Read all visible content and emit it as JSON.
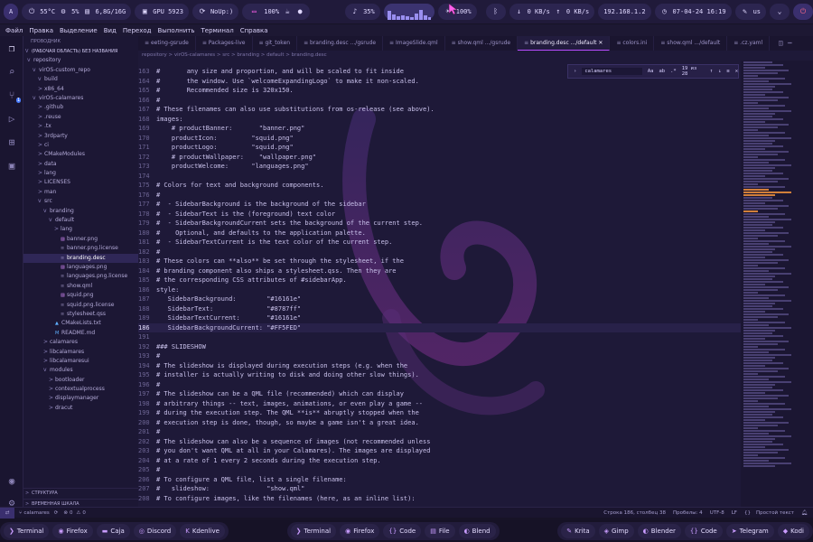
{
  "topbar": {
    "launcher": "A",
    "temp": "55°C",
    "cpu": "5%",
    "mem": "6,8G/16G",
    "gpu": "GPU 5923",
    "noup": "NoUp:)",
    "battery": "100%",
    "volume": "35%",
    "brightness": "100%",
    "net_down": "0 KB/s",
    "net_up": "0 KB/s",
    "ip": "192.168.1.2",
    "clock": "07-04-24 16:19",
    "kbd": "us",
    "accent": "#b84cff"
  },
  "menu": [
    "Файл",
    "Правка",
    "Выделение",
    "Вид",
    "Переход",
    "Выполнить",
    "Терминал",
    "Справка"
  ],
  "explorer": {
    "header": "Проводник",
    "workspace": "(рабочая область) без названия",
    "rows": [
      {
        "d": 0,
        "c": "v",
        "n": "repository",
        "t": "folder"
      },
      {
        "d": 1,
        "c": "v",
        "n": "virOS-custom_repo",
        "t": "folder"
      },
      {
        "d": 2,
        "c": "v",
        "n": "build",
        "t": "folder"
      },
      {
        "d": 2,
        "c": ">",
        "n": "x86_64",
        "t": "folder"
      },
      {
        "d": 1,
        "c": "v",
        "n": "virOS-calamares",
        "t": "folder"
      },
      {
        "d": 2,
        "c": ">",
        "n": ".github",
        "t": "folder"
      },
      {
        "d": 2,
        "c": ">",
        "n": ".reuse",
        "t": "folder"
      },
      {
        "d": 2,
        "c": ">",
        "n": ".tx",
        "t": "folder"
      },
      {
        "d": 2,
        "c": ">",
        "n": "3rdparty",
        "t": "folder"
      },
      {
        "d": 2,
        "c": ">",
        "n": "ci",
        "t": "folder"
      },
      {
        "d": 2,
        "c": ">",
        "n": "CMakeModules",
        "t": "folder"
      },
      {
        "d": 2,
        "c": ">",
        "n": "data",
        "t": "folder"
      },
      {
        "d": 2,
        "c": ">",
        "n": "lang",
        "t": "folder"
      },
      {
        "d": 2,
        "c": ">",
        "n": "LICENSES",
        "t": "folder"
      },
      {
        "d": 2,
        "c": ">",
        "n": "man",
        "t": "folder"
      },
      {
        "d": 2,
        "c": "v",
        "n": "src",
        "t": "folder"
      },
      {
        "d": 3,
        "c": "v",
        "n": "branding",
        "t": "folder"
      },
      {
        "d": 4,
        "c": "v",
        "n": "default",
        "t": "folder"
      },
      {
        "d": 5,
        "c": ">",
        "n": "lang",
        "t": "folder"
      },
      {
        "d": 5,
        "c": "",
        "n": "banner.png",
        "t": "img"
      },
      {
        "d": 5,
        "c": "",
        "n": "banner.png.license",
        "t": "file"
      },
      {
        "d": 5,
        "c": "",
        "n": "branding.desc",
        "t": "file",
        "sel": true
      },
      {
        "d": 5,
        "c": "",
        "n": "languages.png",
        "t": "img"
      },
      {
        "d": 5,
        "c": "",
        "n": "languages.png.license",
        "t": "file"
      },
      {
        "d": 5,
        "c": "",
        "n": "show.qml",
        "t": "file"
      },
      {
        "d": 5,
        "c": "",
        "n": "squid.png",
        "t": "img"
      },
      {
        "d": 5,
        "c": "",
        "n": "squid.png.license",
        "t": "file"
      },
      {
        "d": 5,
        "c": "",
        "n": "stylesheet.qss",
        "t": "file"
      },
      {
        "d": 4,
        "c": "",
        "n": "CMakeLists.txt",
        "t": "cmake"
      },
      {
        "d": 4,
        "c": "",
        "n": "README.md",
        "t": "md"
      },
      {
        "d": 3,
        "c": ">",
        "n": "calamares",
        "t": "folder"
      },
      {
        "d": 3,
        "c": ">",
        "n": "libcalamares",
        "t": "folder"
      },
      {
        "d": 3,
        "c": ">",
        "n": "libcalamaresui",
        "t": "folder"
      },
      {
        "d": 3,
        "c": "v",
        "n": "modules",
        "t": "folder"
      },
      {
        "d": 4,
        "c": ">",
        "n": "bootloader",
        "t": "folder"
      },
      {
        "d": 4,
        "c": ">",
        "n": "contextualprocess",
        "t": "folder"
      },
      {
        "d": 4,
        "c": ">",
        "n": "displaymanager",
        "t": "folder"
      },
      {
        "d": 4,
        "c": ">",
        "n": "dracut",
        "t": "folder"
      }
    ],
    "outline": "Структура",
    "timeline": "Временная шкала"
  },
  "tabs": [
    {
      "label": "eeting-gsrude",
      "active": false
    },
    {
      "label": "Packages-live",
      "active": false
    },
    {
      "label": "git_token",
      "active": false
    },
    {
      "label": "branding.desc .../gsrude",
      "active": false
    },
    {
      "label": "ImageSlide.qml",
      "active": false
    },
    {
      "label": "show.qml .../gsrude",
      "active": false
    },
    {
      "label": "branding.desc .../default",
      "active": true
    },
    {
      "label": "colors.ini",
      "active": false
    },
    {
      "label": "show.qml .../default",
      "active": false
    },
    {
      "label": ".cz.yaml",
      "active": false
    }
  ],
  "breadcrumb": "repository > virOS-calamares > src > branding > default > branding.desc",
  "find": {
    "query": "calamares",
    "result": "19 из 28"
  },
  "code": [
    {
      "n": "163",
      "t": "#       any size and proportion, and will be scaled to fit inside"
    },
    {
      "n": "164",
      "t": "#       the window. Use `welcomeExpandingLogo` to make it non-scaled."
    },
    {
      "n": "165",
      "t": "#       Recommended size is 320x150."
    },
    {
      "n": "166",
      "t": "#"
    },
    {
      "n": "167",
      "t": "# These filenames can also use substitutions from os-release (see above)."
    },
    {
      "n": "168",
      "t": "images:"
    },
    {
      "n": "169",
      "t": "    # productBanner:       \"banner.png\""
    },
    {
      "n": "170",
      "t": "    productIcon:         \"squid.png\""
    },
    {
      "n": "171",
      "t": "    productLogo:         \"squid.png\""
    },
    {
      "n": "172",
      "t": "    # productWallpaper:    \"wallpaper.png\""
    },
    {
      "n": "173",
      "t": "    productWelcome:      \"languages.png\""
    },
    {
      "n": "174",
      "t": ""
    },
    {
      "n": "175",
      "t": "# Colors for text and background components."
    },
    {
      "n": "176",
      "t": "#"
    },
    {
      "n": "177",
      "t": "#  - SidebarBackground is the background of the sidebar"
    },
    {
      "n": "178",
      "t": "#  - SidebarText is the (foreground) text color"
    },
    {
      "n": "179",
      "t": "#  - SidebarBackgroundCurrent sets the background of the current step."
    },
    {
      "n": "180",
      "t": "#    Optional, and defaults to the application palette."
    },
    {
      "n": "181",
      "t": "#  - SidebarTextCurrent is the text color of the current step."
    },
    {
      "n": "182",
      "t": "#"
    },
    {
      "n": "183",
      "t": "# These colors can **also** be set through the stylesheet, if the"
    },
    {
      "n": "184",
      "t": "# branding component also ships a stylesheet.qss. Then they are"
    },
    {
      "n": "185",
      "t": "# the corresponding CSS attributes of #sidebarApp."
    },
    {
      "n": "186",
      "t": "style:"
    },
    {
      "n": "187",
      "t": "   SidebarBackground:        \"#16161e\""
    },
    {
      "n": "188",
      "t": "   SidebarText:              \"#8787ff\""
    },
    {
      "n": "189",
      "t": "   SidebarTextCurrent:       \"#16161e\""
    },
    {
      "n": "186",
      "t": "   SidebarBackgroundCurrent: \"#FF5FED\"",
      "cur": true
    },
    {
      "n": "191",
      "t": ""
    },
    {
      "n": "192",
      "t": "### SLIDESHOW"
    },
    {
      "n": "193",
      "t": "#"
    },
    {
      "n": "194",
      "t": "# The slideshow is displayed during execution steps (e.g. when the"
    },
    {
      "n": "195",
      "t": "# installer is actually writing to disk and doing other slow things)."
    },
    {
      "n": "196",
      "t": "#"
    },
    {
      "n": "197",
      "t": "# The slideshow can be a QML file (recommended) which can display"
    },
    {
      "n": "198",
      "t": "# arbitrary things -- text, images, animations, or even play a game --"
    },
    {
      "n": "199",
      "t": "# during the execution step. The QML **is** abruptly stopped when the"
    },
    {
      "n": "200",
      "t": "# execution step is done, though, so maybe a game isn't a great idea."
    },
    {
      "n": "201",
      "t": "#"
    },
    {
      "n": "202",
      "t": "# The slideshow can also be a sequence of images (not recommended unless"
    },
    {
      "n": "203",
      "t": "# you don't want QML at all in your Calamares). The images are displayed"
    },
    {
      "n": "204",
      "t": "# at a rate of 1 every 2 seconds during the execution step."
    },
    {
      "n": "205",
      "t": "#"
    },
    {
      "n": "206",
      "t": "# To configure a QML file, list a single filename:"
    },
    {
      "n": "207",
      "t": "#   slideshow:               \"show.qml\""
    },
    {
      "n": "208",
      "t": "# To configure images, like the filenames (here, as an inline list):"
    }
  ],
  "statusbar": {
    "branch": "calamares",
    "errors": "0",
    "warnings": "0",
    "position": "Строка 186, столбец 38",
    "spaces": "Пробелы: 4",
    "encoding": "UTF-8",
    "eol": "LF",
    "lang": "Простой текст"
  },
  "taskbar": {
    "left": [
      {
        "icon": "terminal-icon",
        "label": "Terminal"
      },
      {
        "icon": "firefox-icon",
        "label": "Firefox"
      },
      {
        "icon": "folder-icon",
        "label": "Caja"
      },
      {
        "icon": "discord-icon",
        "label": "Discord"
      },
      {
        "icon": "kdenlive-icon",
        "label": "Kdenlive"
      }
    ],
    "center": [
      {
        "icon": "terminal-icon",
        "label": "Terminal"
      },
      {
        "icon": "firefox-icon",
        "label": "Firefox"
      },
      {
        "icon": "code-icon",
        "label": "Code"
      },
      {
        "icon": "file-icon",
        "label": "File"
      },
      {
        "icon": "blender-icon",
        "label": "Blend"
      }
    ],
    "right": [
      {
        "icon": "krita-icon",
        "label": "Krita"
      },
      {
        "icon": "gimp-icon",
        "label": "Gimp"
      },
      {
        "icon": "blender-icon",
        "label": "Blender"
      },
      {
        "icon": "code-icon",
        "label": "Code"
      },
      {
        "icon": "telegram-icon",
        "label": "Telegram"
      },
      {
        "icon": "kodi-icon",
        "label": "Kodi"
      }
    ]
  }
}
